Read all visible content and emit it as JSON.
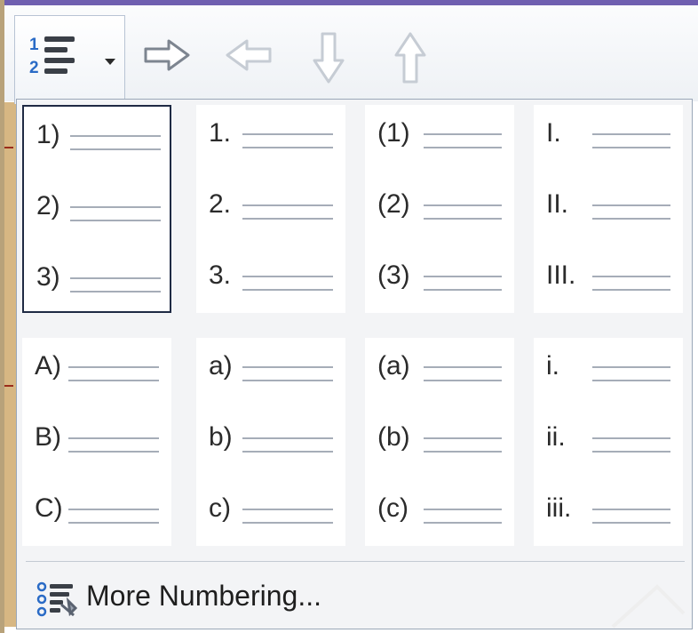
{
  "numbering_formats": [
    {
      "items": [
        "1)",
        "2)",
        "3)"
      ],
      "selected": true
    },
    {
      "items": [
        "1.",
        "2.",
        "3."
      ],
      "selected": false
    },
    {
      "items": [
        "(1)",
        "(2)",
        "(3)"
      ],
      "selected": false
    },
    {
      "items": [
        "I.",
        "II.",
        "III."
      ],
      "selected": false
    },
    {
      "items": [
        "A)",
        "B)",
        "C)"
      ],
      "selected": false
    },
    {
      "items": [
        "a)",
        "b)",
        "c)"
      ],
      "selected": false
    },
    {
      "items": [
        "(a)",
        "(b)",
        "(c)"
      ],
      "selected": false
    },
    {
      "items": [
        "i.",
        "ii.",
        "iii."
      ],
      "selected": false
    }
  ],
  "toolbar": {
    "numbering_button_icon": "numbered-list-icon",
    "numbering_button_glyphs": [
      "1",
      "2"
    ],
    "dropdown_icon": "chevron-down-icon",
    "arrows": [
      "arrow-right-icon",
      "arrow-left-icon",
      "arrow-down-icon",
      "arrow-up-icon"
    ]
  },
  "more_numbering": {
    "label": "More Numbering...",
    "icon": "numbering-settings-icon"
  },
  "colors": {
    "accent_blue": "#2a6bc6",
    "selection_border": "#1f2a44"
  }
}
